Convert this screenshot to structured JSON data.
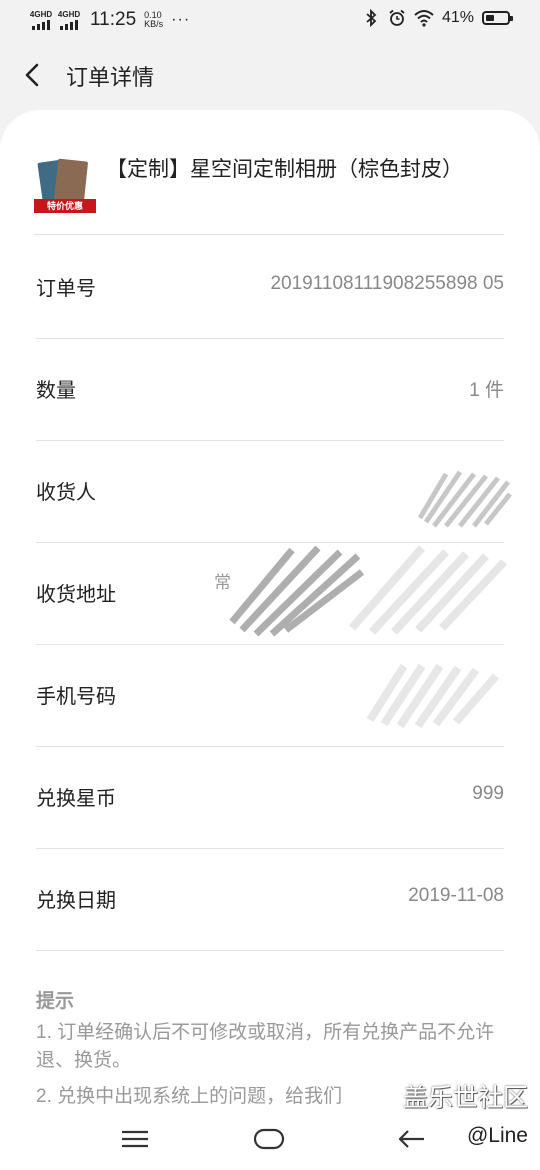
{
  "status_bar": {
    "net1": "4GHD",
    "net2": "4GHD",
    "time": "11:25",
    "speed_value": "0.10",
    "speed_unit": "KB/s",
    "more": "···",
    "battery_pct": "41%",
    "battery_level": 0.41
  },
  "header": {
    "title": "订单详情",
    "back_icon": "back-arrow-icon"
  },
  "product": {
    "name": "【定制】星空间定制相册（棕色封皮）",
    "tag": "特价优惠"
  },
  "rows": [
    {
      "label": "订单号",
      "value": "20191108111908255898 05"
    },
    {
      "label": "数量",
      "value": "1 件"
    },
    {
      "label": "收货人",
      "value": ""
    },
    {
      "label": "收货地址",
      "value": "常"
    },
    {
      "label": "手机号码",
      "value": ""
    },
    {
      "label": "兑换星币",
      "value": "999"
    },
    {
      "label": "兑换日期",
      "value": "2019-11-08"
    }
  ],
  "tips": {
    "title": "提示",
    "items": [
      "1. 订单经确认后不可修改或取消，所有兑换产品不允许退、换货。",
      "2. 兑换中出现系统上的问题，给我们"
    ]
  },
  "watermark": {
    "line1": "盖乐世社区",
    "line2": "@Line"
  },
  "colors": {
    "accent_tag": "#c8161d",
    "background": "#f2f2f2",
    "card": "#ffffff"
  }
}
